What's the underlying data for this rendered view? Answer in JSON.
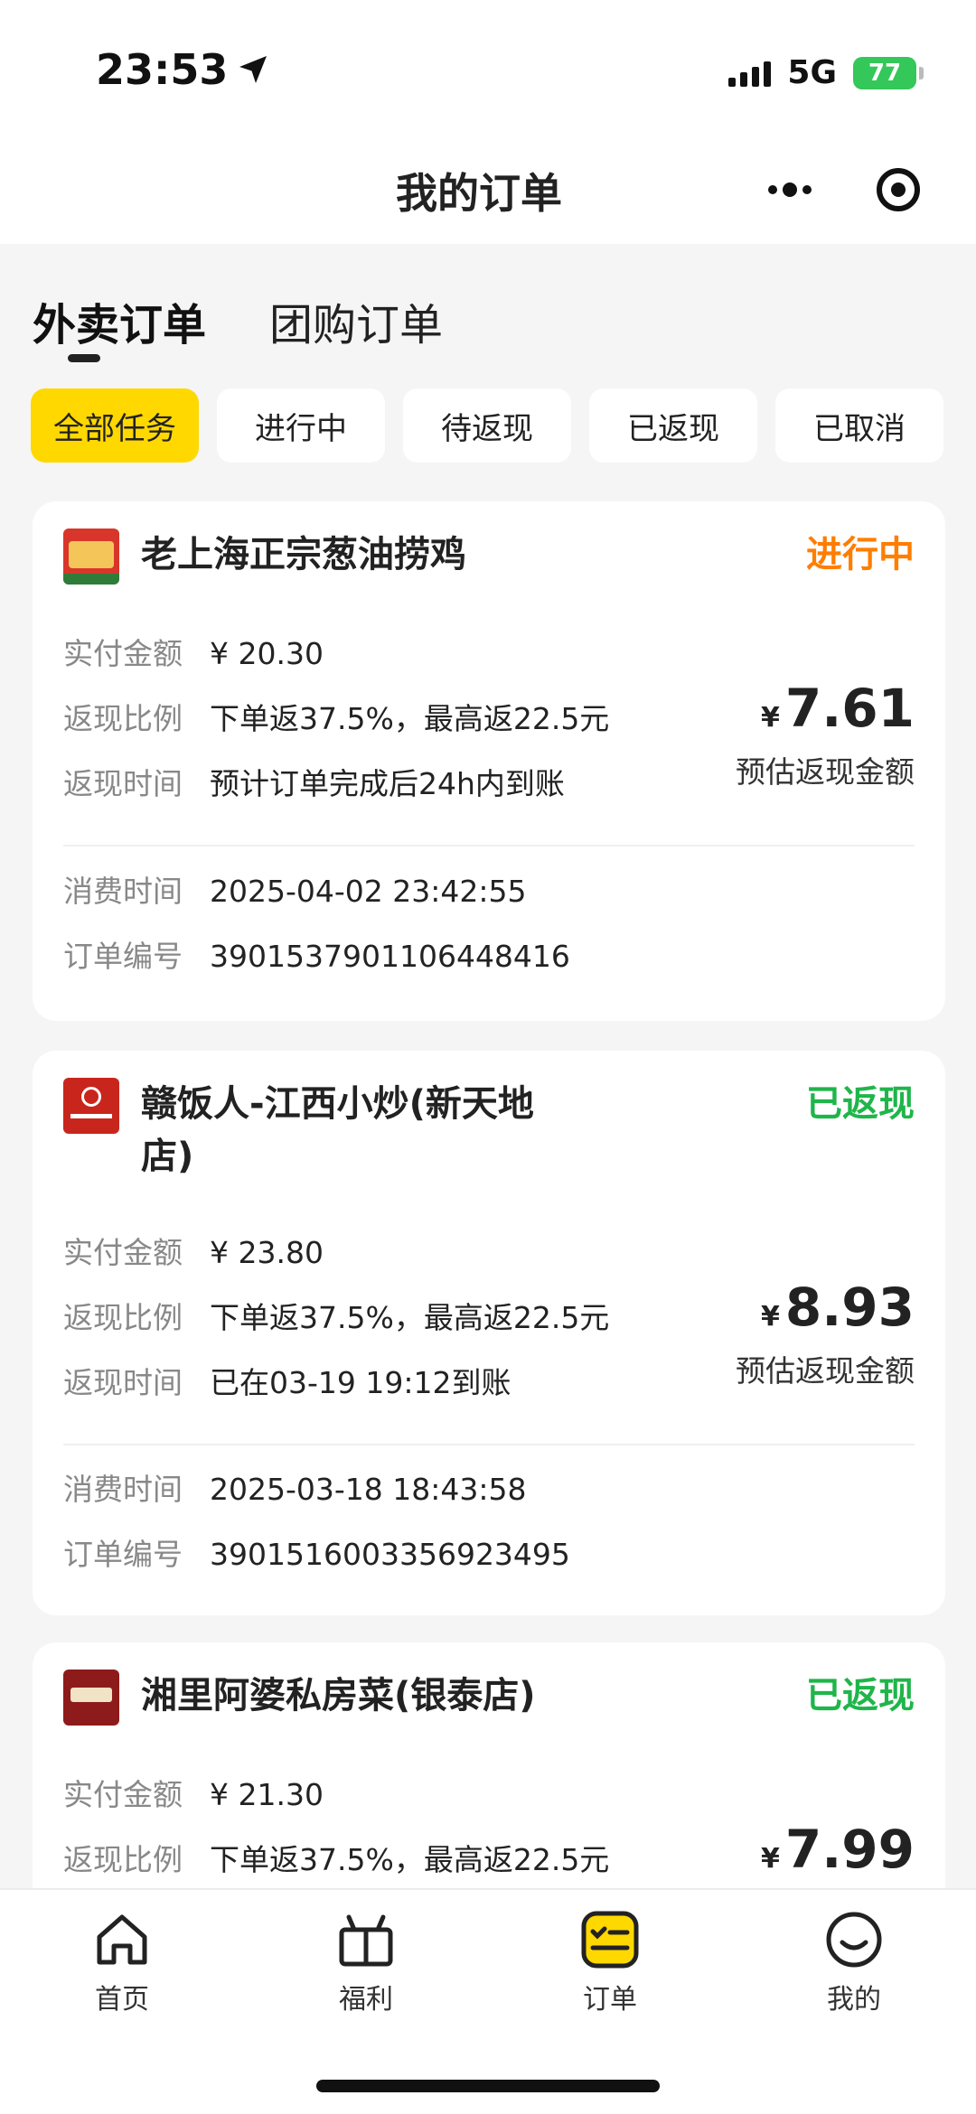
{
  "status_bar": {
    "time": "23:53",
    "network": "5G",
    "battery": "77"
  },
  "nav": {
    "title": "我的订单",
    "more_icon": "more-dots-icon",
    "close_icon": "target-icon"
  },
  "order_tabs": [
    {
      "label": "外卖订单",
      "active": true
    },
    {
      "label": "团购订单",
      "active": false
    }
  ],
  "filters": [
    {
      "label": "全部任务",
      "active": true
    },
    {
      "label": "进行中",
      "active": false
    },
    {
      "label": "待返现",
      "active": false
    },
    {
      "label": "已返现",
      "active": false
    },
    {
      "label": "已取消",
      "active": false
    }
  ],
  "labels": {
    "paid": "实付金额",
    "ratio": "返现比例",
    "cash_time": "返现时间",
    "consume_time": "消费时间",
    "order_no": "订单编号",
    "estimate": "预估返现金额",
    "yen": "¥"
  },
  "orders": [
    {
      "shop": "老上海正宗葱油捞鸡",
      "status": "进行中",
      "status_color": "#ff7d00",
      "paid": "¥ 20.30",
      "ratio": "下单返37.5%，最高返22.5元",
      "cash_time": "预计订单完成后24h内到账",
      "cashback": "7.61",
      "consume_time": "2025-04-02 23:42:55",
      "order_no": "3901537901106448416"
    },
    {
      "shop": "赣饭人-江西小炒(新天地店)",
      "status": "已返现",
      "status_color": "#1fb54a",
      "paid": "¥ 23.80",
      "ratio": "下单返37.5%，最高返22.5元",
      "cash_time": "已在03-19 19:12到账",
      "cashback": "8.93",
      "consume_time": "2025-03-18 18:43:58",
      "order_no": "3901516003356923495"
    },
    {
      "shop": "湘里阿婆私房菜(银泰店)",
      "status": "已返现",
      "status_color": "#1fb54a",
      "paid": "¥ 21.30",
      "ratio": "下单返37.5%，最高返22.5元",
      "cashback": "7.99"
    }
  ],
  "tabbar": [
    {
      "label": "首页",
      "icon": "home-icon"
    },
    {
      "label": "福利",
      "icon": "gift-icon"
    },
    {
      "label": "订单",
      "icon": "order-list-icon",
      "active": true
    },
    {
      "label": "我的",
      "icon": "smile-icon"
    }
  ]
}
